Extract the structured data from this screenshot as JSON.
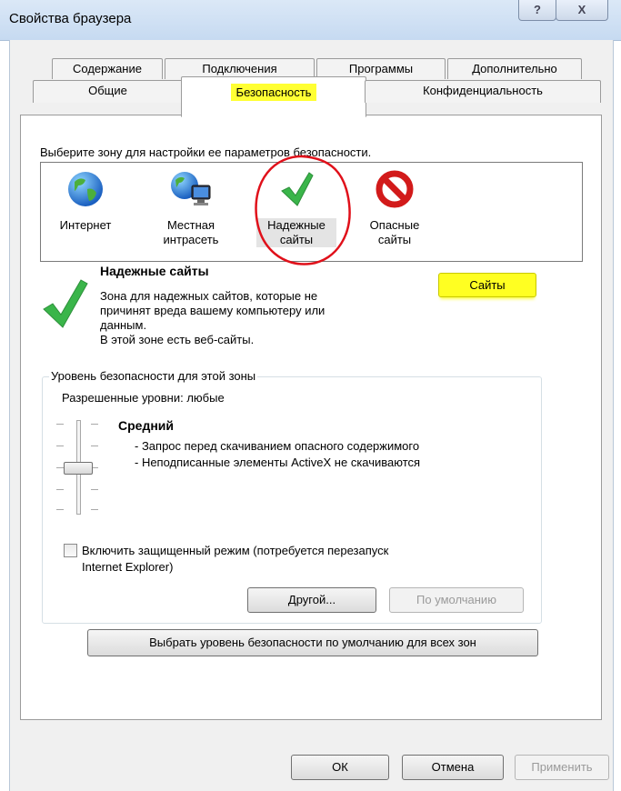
{
  "window": {
    "title": "Свойства браузера",
    "help_label": "?",
    "close_label": "X"
  },
  "tabs": {
    "row1": [
      "Содержание",
      "Подключения",
      "Программы",
      "Дополнительно"
    ],
    "row2": [
      "Общие",
      "Безопасность",
      "Конфиденциальность"
    ],
    "selected": "Безопасность"
  },
  "security": {
    "instruction": "Выберите зону для настройки ее параметров безопасности.",
    "zones": [
      {
        "line1": "Интернет",
        "line2": "",
        "icon": "globe-icon"
      },
      {
        "line1": "Местная",
        "line2": "интрасеть",
        "icon": "intranet-icon"
      },
      {
        "line1": "Надежные",
        "line2": "сайты",
        "icon": "checkmark-icon"
      },
      {
        "line1": "Опасные",
        "line2": "сайты",
        "icon": "prohibited-icon"
      }
    ],
    "selected_zone": "Надежные сайты",
    "zone_title": "Надежные сайты",
    "zone_desc": [
      "Зона для надежных сайтов, которые не",
      "причинят вреда вашему компьютеру или",
      "данным.",
      "В этой зоне есть веб-сайты."
    ],
    "sites_button": "Сайты",
    "level_group_label": "Уровень безопасности для этой зоны",
    "allowed_levels": "Разрешенные уровни: любые",
    "level_name": "Средний",
    "level_desc": [
      "- Запрос перед скачиванием опасного содержимого",
      "- Неподписанные элементы ActiveX не скачиваются"
    ],
    "slider_level": "Средний",
    "protected_mode_line1": "Включить защищенный режим (потребуется перезапуск",
    "protected_mode_line2": "Internet Explorer)",
    "protected_mode_checked": false,
    "custom_button": "Другой...",
    "default_button": "По умолчанию",
    "reset_all_button": "Выбрать уровень безопасности по умолчанию для всех зон"
  },
  "footer": {
    "ok": "ОК",
    "cancel": "Отмена",
    "apply": "Применить"
  },
  "colors": {
    "highlight": "#ffff33",
    "annotation_circle": "#e0101a",
    "checkmark": "#3ab54a"
  }
}
